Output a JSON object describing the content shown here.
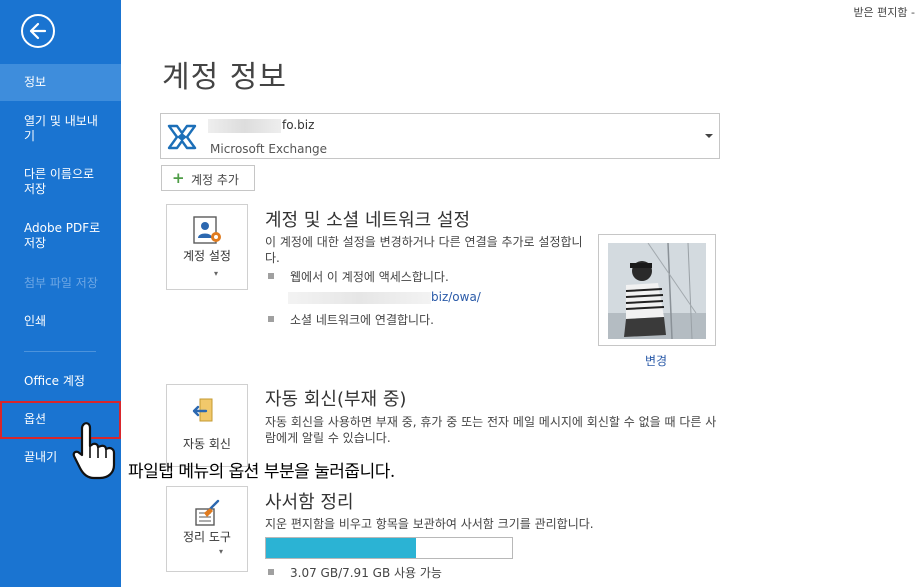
{
  "topbar": {
    "right_text": "받은 편지함 -"
  },
  "sidebar": {
    "items": [
      {
        "label": "정보",
        "state": "active"
      },
      {
        "label": "열기 및 내보내기"
      },
      {
        "label": "다른 이름으로 저장"
      },
      {
        "label": "Adobe PDF로 저장"
      },
      {
        "label": "첨부 파일 저장",
        "state": "disabled"
      },
      {
        "label": "인쇄"
      },
      {
        "label": "Office 계정"
      },
      {
        "label": "옵션",
        "state": "highlighted"
      },
      {
        "label": "끝내기"
      }
    ]
  },
  "main": {
    "title": "계정 정보",
    "account": {
      "email": "fo.biz",
      "type": "Microsoft Exchange"
    },
    "add_account_label": "계정 추가",
    "account_settings": {
      "tile_label": "계정 설정",
      "title": "계정 및 소셜 네트워크 설정",
      "desc": "이 계정에 대한 설정을 변경하거나 다른 연결을 추가로 설정합니다.",
      "bullet1": "웹에서 이 계정에 액세스합니다.",
      "link": "biz/owa/",
      "bullet2": "소셜 네트워크에 연결합니다.",
      "change_label": "변경"
    },
    "auto_reply": {
      "tile_label": "자동 회신",
      "title": "자동 회신(부재 중)",
      "desc": "자동 회신을 사용하면 부재 중, 휴가 중 또는 전자 메일 메시지에 회신할 수 없을 때 다른 사람에게 알릴 수 있습니다."
    },
    "cleanup": {
      "tile_label": "정리 도구",
      "title": "사서함 정리",
      "desc": "지운 편지함을 비우고 항목을 보관하여 사서함 크기를 관리합니다.",
      "usage": "3.07 GB/7.91 GB 사용 가능",
      "progress": 0.61
    }
  },
  "annotation": "파일탭 메뉴의 옵션 부분을 눌러줍니다.",
  "colors": {
    "sidebar": "#1a74d1",
    "active": "#3e8ddc",
    "highlight": "#d9262b",
    "progress": "#2bb3d4",
    "link": "#2a5aa8"
  }
}
